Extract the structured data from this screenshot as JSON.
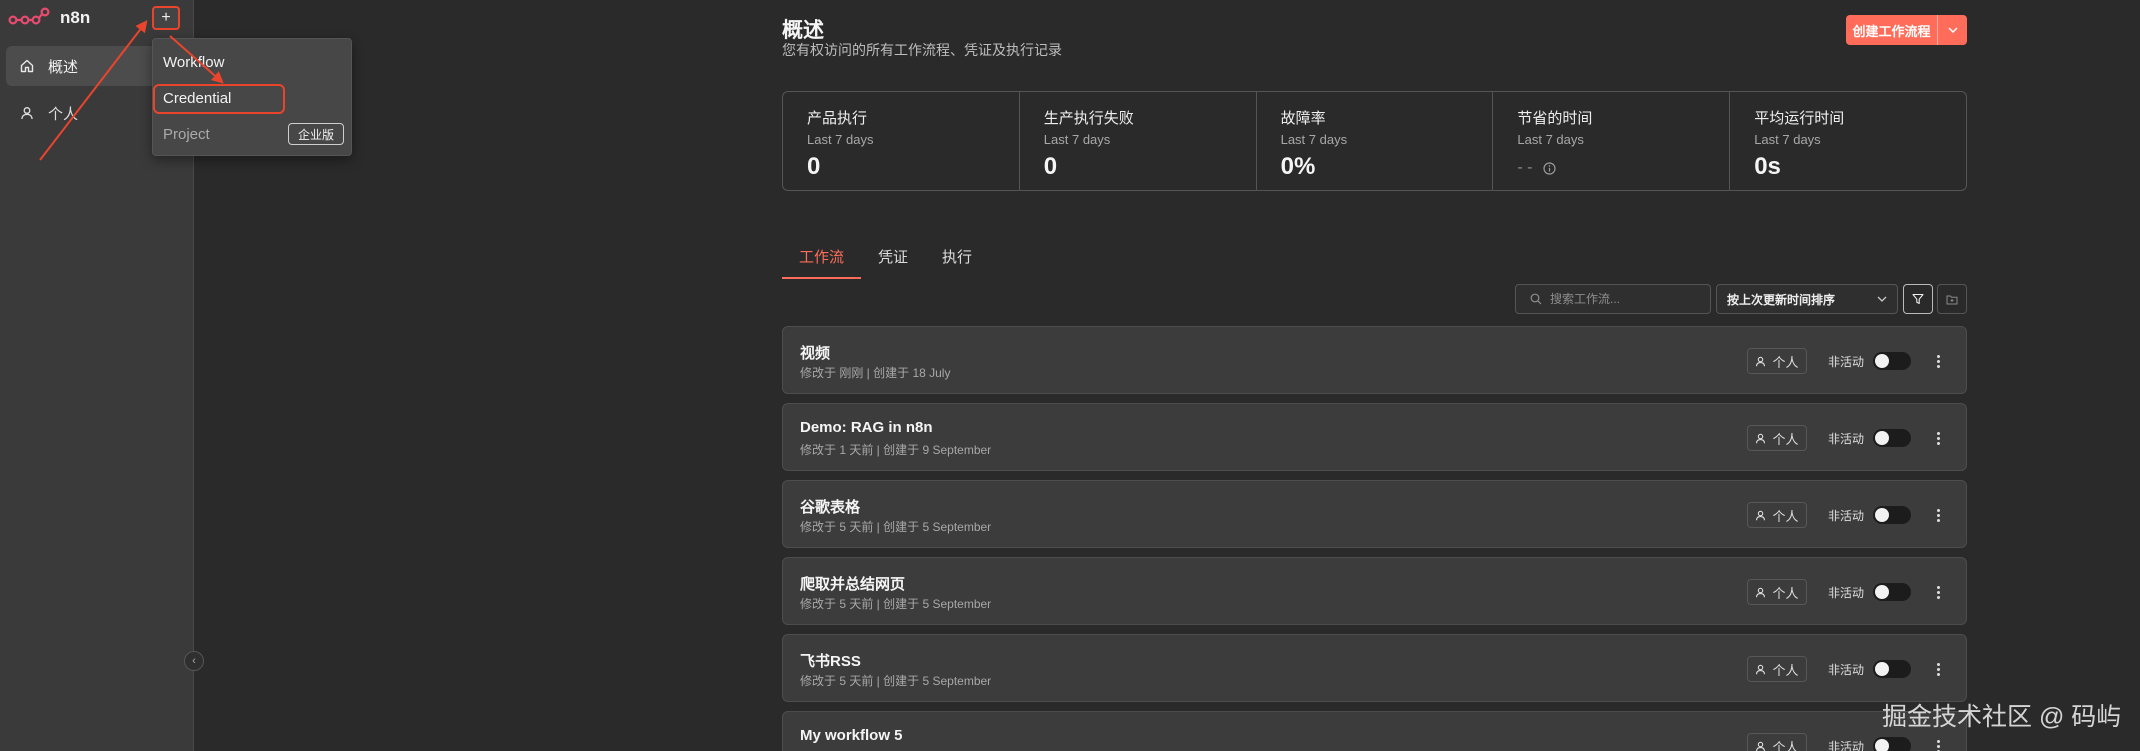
{
  "brand": {
    "name": "n8n"
  },
  "sidebar": {
    "add_label": "+",
    "items": [
      {
        "label": "概述",
        "icon": "home-icon",
        "active": true
      },
      {
        "label": "个人",
        "icon": "user-icon",
        "active": false
      }
    ],
    "collapse_label": "‹"
  },
  "dropdown": {
    "items": [
      {
        "label": "Workflow"
      },
      {
        "label": "Credential"
      },
      {
        "label": "Project",
        "badge": "企业版"
      }
    ]
  },
  "header": {
    "title": "概述",
    "subtitle": "您有权访问的所有工作流程、凭证及执行记录",
    "create_button": "创建工作流程"
  },
  "stats": [
    {
      "title": "产品执行",
      "period": "Last 7 days",
      "value": "0"
    },
    {
      "title": "生产执行失败",
      "period": "Last 7 days",
      "value": "0"
    },
    {
      "title": "故障率",
      "period": "Last 7 days",
      "value": "0%"
    },
    {
      "title": "节省的时间",
      "period": "Last 7 days",
      "value": "- -"
    },
    {
      "title": "平均运行时间",
      "period": "Last 7 days",
      "value": "0s"
    }
  ],
  "tabs": [
    {
      "label": "工作流",
      "active": true
    },
    {
      "label": "凭证",
      "active": false
    },
    {
      "label": "执行",
      "active": false
    }
  ],
  "toolbar": {
    "search_placeholder": "搜索工作流...",
    "sort_label": "按上次更新时间排序"
  },
  "workflows": [
    {
      "name": "视频",
      "meta": "修改于 刚刚 | 创建于 18 July",
      "owner": "个人",
      "status": "非活动"
    },
    {
      "name": "Demo: RAG in n8n",
      "meta": "修改于 1 天前 | 创建于 9 September",
      "owner": "个人",
      "status": "非活动"
    },
    {
      "name": "谷歌表格",
      "meta": "修改于 5 天前 | 创建于 5 September",
      "owner": "个人",
      "status": "非活动"
    },
    {
      "name": "爬取并总结网页",
      "meta": "修改于 5 天前 | 创建于 5 September",
      "owner": "个人",
      "status": "非活动"
    },
    {
      "name": "飞书RSS",
      "meta": "修改于 5 天前 | 创建于 5 September",
      "owner": "个人",
      "status": "非活动"
    },
    {
      "name": "My workflow 5",
      "meta": "",
      "owner": "个人",
      "status": "非活动"
    }
  ],
  "watermark": "掘金技术社区 @ 码屿",
  "colors": {
    "accent": "#ff6d5a",
    "annotation": "#e8452c",
    "background": "#2a2a2a",
    "sidebar": "#3a3a3a"
  }
}
